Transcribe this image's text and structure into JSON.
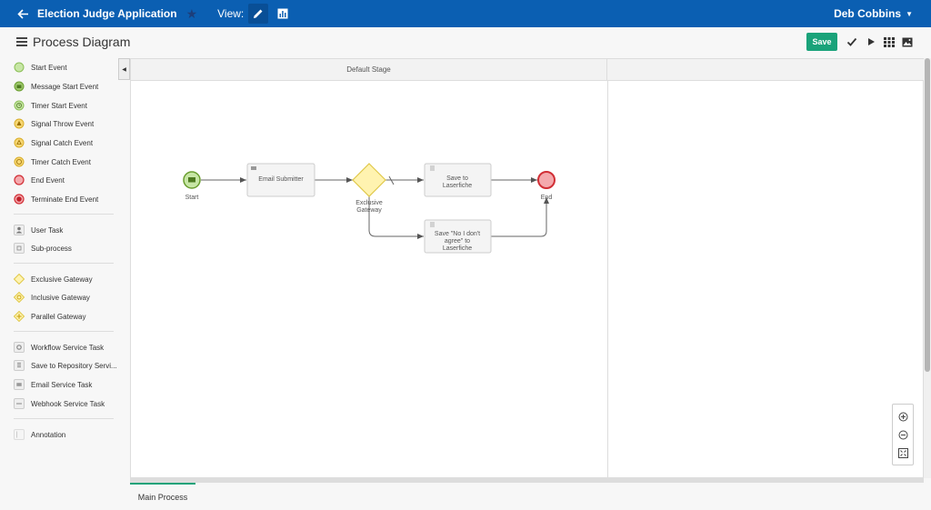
{
  "topbar": {
    "app_title": "Election Judge Application",
    "view_label": "View:",
    "user_name": "Deb Cobbins"
  },
  "header": {
    "title": "Process Diagram",
    "save_label": "Save"
  },
  "palette": {
    "events": [
      {
        "label": "Start Event",
        "icon": "start-event-icon"
      },
      {
        "label": "Message Start Event",
        "icon": "message-start-event-icon"
      },
      {
        "label": "Timer Start Event",
        "icon": "timer-start-event-icon"
      },
      {
        "label": "Signal Throw Event",
        "icon": "signal-throw-event-icon"
      },
      {
        "label": "Signal Catch Event",
        "icon": "signal-catch-event-icon"
      },
      {
        "label": "Timer Catch Event",
        "icon": "timer-catch-event-icon"
      },
      {
        "label": "End Event",
        "icon": "end-event-icon"
      },
      {
        "label": "Terminate End Event",
        "icon": "terminate-end-event-icon"
      }
    ],
    "tasks": [
      {
        "label": "User Task",
        "icon": "user-task-icon"
      },
      {
        "label": "Sub-process",
        "icon": "sub-process-icon"
      }
    ],
    "gateways": [
      {
        "label": "Exclusive Gateway",
        "icon": "exclusive-gateway-icon"
      },
      {
        "label": "Inclusive Gateway",
        "icon": "inclusive-gateway-icon"
      },
      {
        "label": "Parallel Gateway",
        "icon": "parallel-gateway-icon"
      }
    ],
    "services": [
      {
        "label": "Workflow Service Task",
        "icon": "workflow-service-task-icon"
      },
      {
        "label": "Save to Repository Servi...",
        "icon": "save-to-repository-icon"
      },
      {
        "label": "Email Service Task",
        "icon": "email-service-task-icon"
      },
      {
        "label": "Webhook Service Task",
        "icon": "webhook-service-task-icon"
      }
    ],
    "other": [
      {
        "label": "Annotation",
        "icon": "annotation-icon"
      }
    ]
  },
  "canvas": {
    "stage_label": "Default Stage",
    "nodes": {
      "start_label": "Start",
      "email_label": "Email Submitter",
      "gateway_label_line1": "Exclusive",
      "gateway_label_line2": "Gateway",
      "save1_line1": "Save to",
      "save1_line2": "Laserfiche",
      "save2_line1": "Save \"No I don't",
      "save2_line2": "agree\" to",
      "save2_line3": "Laserfiche",
      "end_label": "End"
    }
  },
  "tabs": {
    "main_process": "Main Process"
  },
  "colors": {
    "topbar": "#0b5fb2",
    "save_button": "#1aa37a",
    "start_fill": "#c7e6a5",
    "start_stroke": "#6a9e2f",
    "gateway_fill": "#fff3b0",
    "gateway_stroke": "#e0c84a",
    "end_fill": "#f4a9ad",
    "end_stroke": "#d12f36"
  }
}
